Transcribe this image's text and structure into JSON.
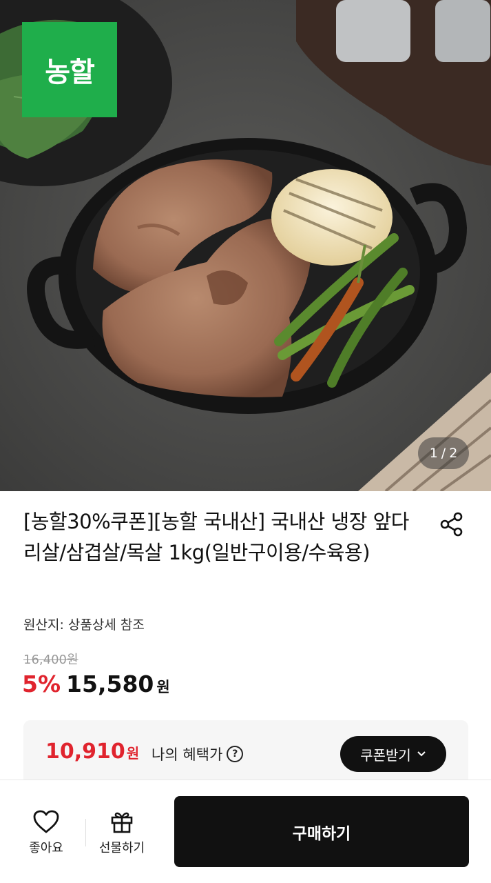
{
  "hero": {
    "brand_logo_text": "농할",
    "image_index": "1",
    "image_separator": "/",
    "image_total": "2"
  },
  "product": {
    "title": "[농할30%쿠폰][농할 국내산] 국내산 냉장 앞다리살/삼겹살/목살 1kg(일반구이용/수육용)",
    "origin": "원산지: 상품상세 참조",
    "original_price": "16,400원",
    "discount": "5%",
    "price": "15,580",
    "price_unit": "원"
  },
  "benefit": {
    "price": "10,910",
    "price_unit": "원",
    "label": "나의 혜택가",
    "help_icon": "?",
    "coupon_button": "쿠폰받기"
  },
  "bottom_bar": {
    "like_label": "좋아요",
    "gift_label": "선물하기",
    "buy_label": "구매하기"
  },
  "colors": {
    "brand_green": "#1fae4b",
    "sale_red": "#e0242e",
    "button_black": "#111111"
  },
  "icons": {
    "share": "share-icon",
    "like": "heart-icon",
    "gift": "gift-icon",
    "coupon": "chevron-down-icon"
  }
}
